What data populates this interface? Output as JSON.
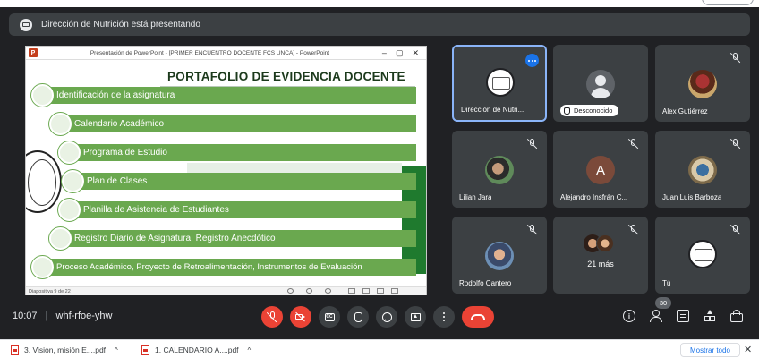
{
  "banner": {
    "text": "Dirección de Nutrición está presentando"
  },
  "presentation": {
    "window_title": "Presentación de PowerPoint - [PRIMER ENCUENTRO DOCENTE FCS UNCA] - PowerPoint",
    "slide_title": "PORTAFOLIO DE EVIDENCIA DOCENTE",
    "items": [
      "Identificación de la asignatura",
      "Calendario Académico",
      "Programa de Estudio",
      "Plan de Clases",
      "Planilla de Asistencia de Estudiantes",
      "Registro Diario de Asignatura, Registro Anecdótico",
      "Proceso Académico, Proyecto de Retroalimentación, Instrumentos de Evaluación"
    ],
    "status": "Diapositiva 9 de 22",
    "accent": "#6aa84f"
  },
  "participants": [
    {
      "name": "Dirección de Nutri...",
      "avatar": "logo",
      "muted": false,
      "active": true
    },
    {
      "name": "Desconocido",
      "avatar": "grey",
      "muted": false,
      "chip": true
    },
    {
      "name": "Alex Gutiérrez",
      "avatar": "photo1",
      "muted": true
    },
    {
      "name": "Lilian Jara",
      "avatar": "photo2",
      "muted": true
    },
    {
      "name": "Alejandro Insfrán C...",
      "avatar": "letter",
      "letter": "A",
      "muted": true
    },
    {
      "name": "Juan Luis Barboza",
      "avatar": "photo3",
      "muted": true
    },
    {
      "name": "Rodolfo Cantero",
      "avatar": "photo4",
      "muted": true
    },
    {
      "name": "21 más",
      "avatar": "multi",
      "muted": true
    },
    {
      "name": "Tú",
      "avatar": "logo",
      "muted": true
    }
  ],
  "meeting": {
    "time": "10:07",
    "separator": "|",
    "code": "whf-rfoe-yhw",
    "participant_count": "30"
  },
  "controls": {
    "captions_label": "CC"
  },
  "downloads": {
    "items": [
      {
        "name": "3. Vision, misión E....pdf"
      },
      {
        "name": "1. CALENDARIO A....pdf"
      }
    ],
    "show_all": "Mostrar todo",
    "close": "✕",
    "caret": "^"
  },
  "icons": {
    "ppt_logo": "P",
    "win_controls": [
      "–",
      "▢",
      "✕"
    ],
    "info": "i"
  }
}
